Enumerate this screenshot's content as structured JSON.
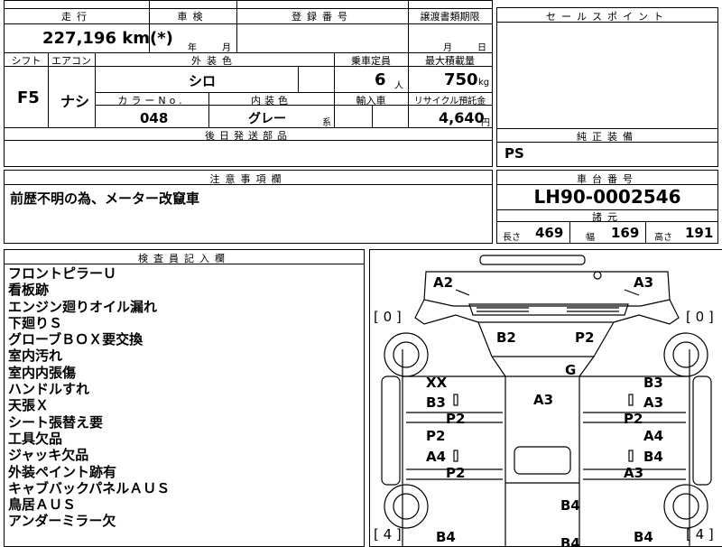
{
  "top": {
    "mileage_header": "走行",
    "inspection_header": "車検",
    "registration_header": "登録番号",
    "transfer_header": "譲渡書類期限",
    "mileage_value": "227,196 km(*)",
    "year_label": "年",
    "month_label": "月",
    "transfer_month": "月",
    "transfer_day": "日",
    "shift_header": "シフト",
    "ac_header": "エアコン",
    "color_header": "外装色",
    "capacity_header": "乗車定員",
    "load_header": "最大積載量",
    "shift_value": "F5",
    "ac_value": "ナシ",
    "color_value": "シロ",
    "capacity_value": "6",
    "capacity_unit": "人",
    "load_value": "750",
    "load_unit": "kg",
    "colorno_header": "カラーNo.",
    "interior_header": "内装色",
    "import_header": "輸入車",
    "recycle_header": "リサイクル預託金",
    "colorno_value": "048",
    "interior_value": "グレー",
    "interior_suffix": "系",
    "recycle_value": "4,640",
    "recycle_unit": "円",
    "later_header": "後日発送部品",
    "notes_header": "注意事項欄",
    "notes_value": "前歴不明の為、メーター改竄車"
  },
  "right": {
    "sales_header": "セールスポイント",
    "genuine_header": "純正装備",
    "genuine_value": "PS",
    "chassis_header": "車台番号",
    "chassis_value": "LH90-0002546",
    "spec_header": "諸元",
    "length_label": "長さ",
    "length_value": "469",
    "width_label": "幅",
    "width_value": "169",
    "height_label": "高さ",
    "height_value": "191"
  },
  "inspector": {
    "header": "検査員記入欄",
    "items": [
      "フロントピラーＵ",
      "看板跡",
      "エンジン廻りオイル漏れ",
      "下廻りＳ",
      "グローブＢＯＸ要交換",
      "室内汚れ",
      "室内内張傷",
      "ハンドルすれ",
      "天張Ｘ",
      "シート張替え要",
      "工具欠品",
      "ジャッキ欠品",
      "外装ペイント跡有",
      "キャブバックパネルＡＵＳ",
      "鳥居ＡＵＳ",
      "アンダーミラー欠"
    ]
  },
  "diagram": {
    "tire_fl": "[ 0 ]",
    "tire_fr": "[ 0 ]",
    "tire_rl": "[ 4 ]",
    "tire_rr": "[ 4 ]",
    "codes": {
      "a2": "A2",
      "a3_top": "A3",
      "b2": "B2",
      "p2_roof": "P2",
      "g": "G",
      "xx": "XX",
      "b3_l": "B3",
      "p2_l1": "P2",
      "p2_l2": "P2",
      "a4_l": "A4",
      "p2_l3": "P2",
      "a3_c": "A3",
      "b3_r": "B3",
      "a3_r1": "A3",
      "p2_r": "P2",
      "a4_r": "A4",
      "b4_r": "B4",
      "a3_r2": "A3",
      "b4_c": "B4",
      "b4_bl": "B4",
      "b4_bc": "B4",
      "b4_br": "B4"
    }
  }
}
